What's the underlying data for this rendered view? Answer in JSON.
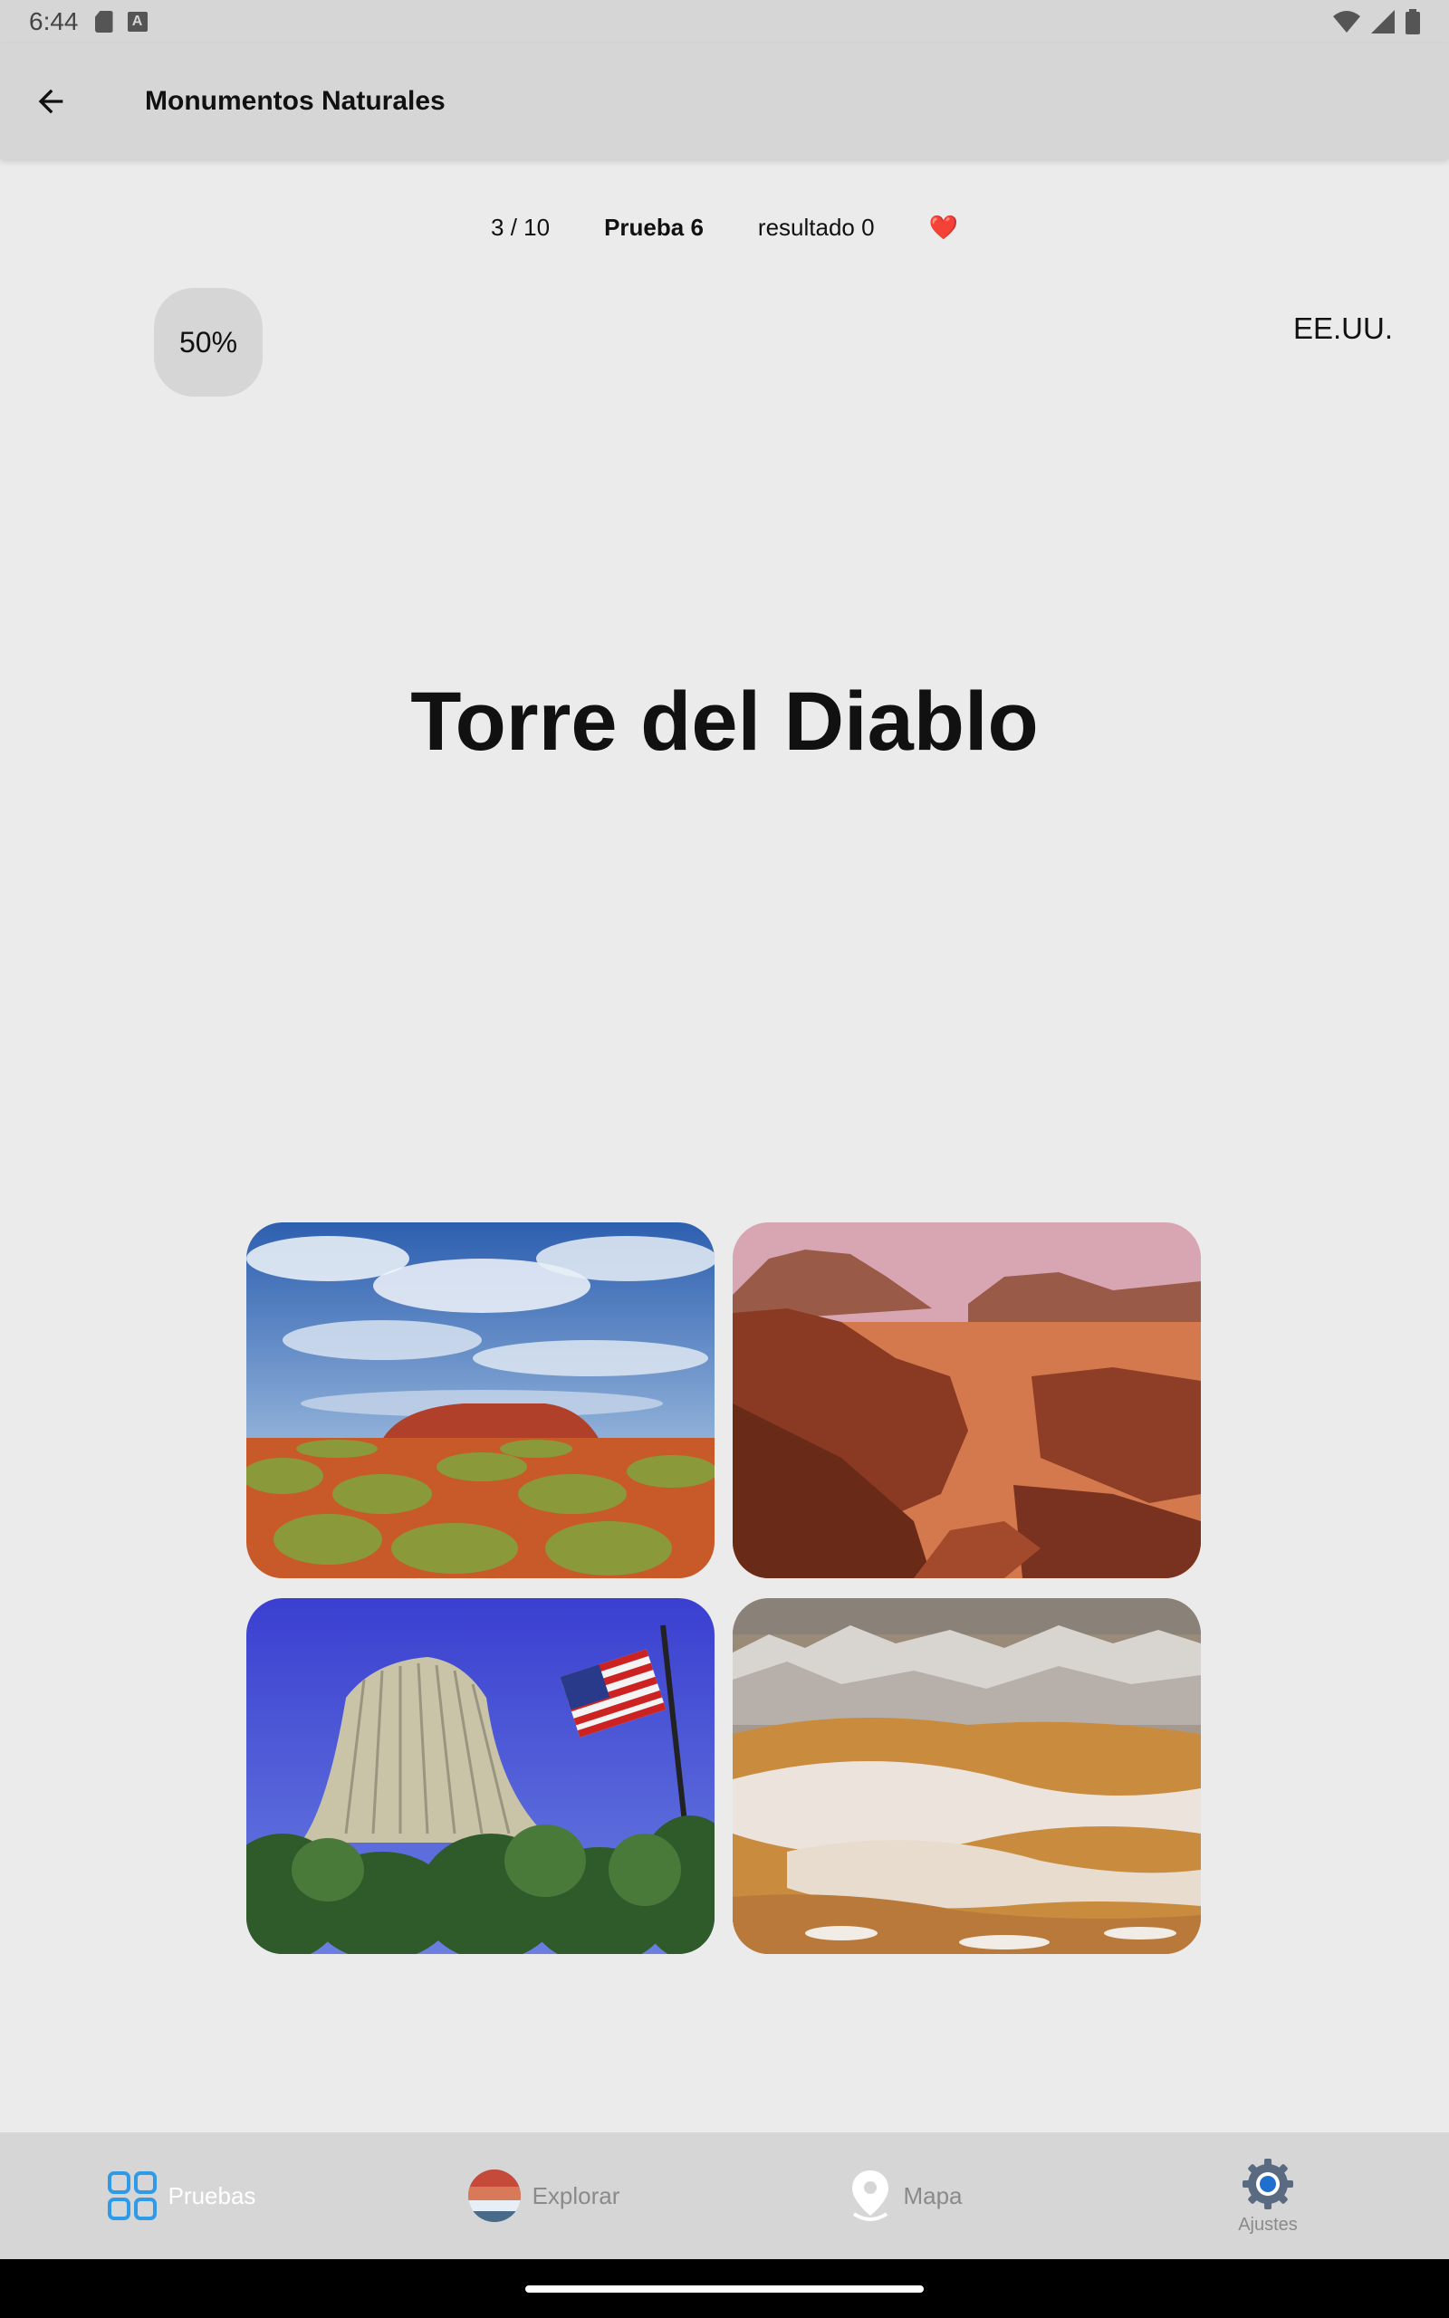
{
  "status_bar": {
    "time": "6:44",
    "icons": [
      "sd-card-icon",
      "a-icon",
      "wifi-icon",
      "signal-icon",
      "battery-icon"
    ]
  },
  "app_bar": {
    "title": "Monumentos Naturales",
    "back_icon": "arrow-left-icon"
  },
  "quiz": {
    "progress": "3 / 10",
    "name": "Prueba 6",
    "score": "resultado 0",
    "lives_icon": "heart-icon",
    "heart": "❤️",
    "percent": "50%",
    "country": "EE.UU.",
    "question": "Torre del Diablo"
  },
  "options": [
    {
      "id": "uluru",
      "description_icon": "uluru-photo"
    },
    {
      "id": "wadi-rum",
      "description_icon": "wadi-rum-photo"
    },
    {
      "id": "devils-tower",
      "description_icon": "devils-tower-photo"
    },
    {
      "id": "dunes",
      "description_icon": "sand-dunes-photo"
    }
  ],
  "bottom_nav": {
    "items": [
      {
        "label": "Pruebas",
        "icon": "grid-icon",
        "active": true
      },
      {
        "label": "Explorar",
        "icon": "globe-icon",
        "active": false
      },
      {
        "label": "Mapa",
        "icon": "map-pin-icon",
        "active": false
      },
      {
        "label": "Ajustes",
        "icon": "gear-icon",
        "active": false
      }
    ]
  },
  "colors": {
    "accent": "#2f9be8",
    "background": "#ebebeb",
    "bar": "#d6d6d6"
  }
}
